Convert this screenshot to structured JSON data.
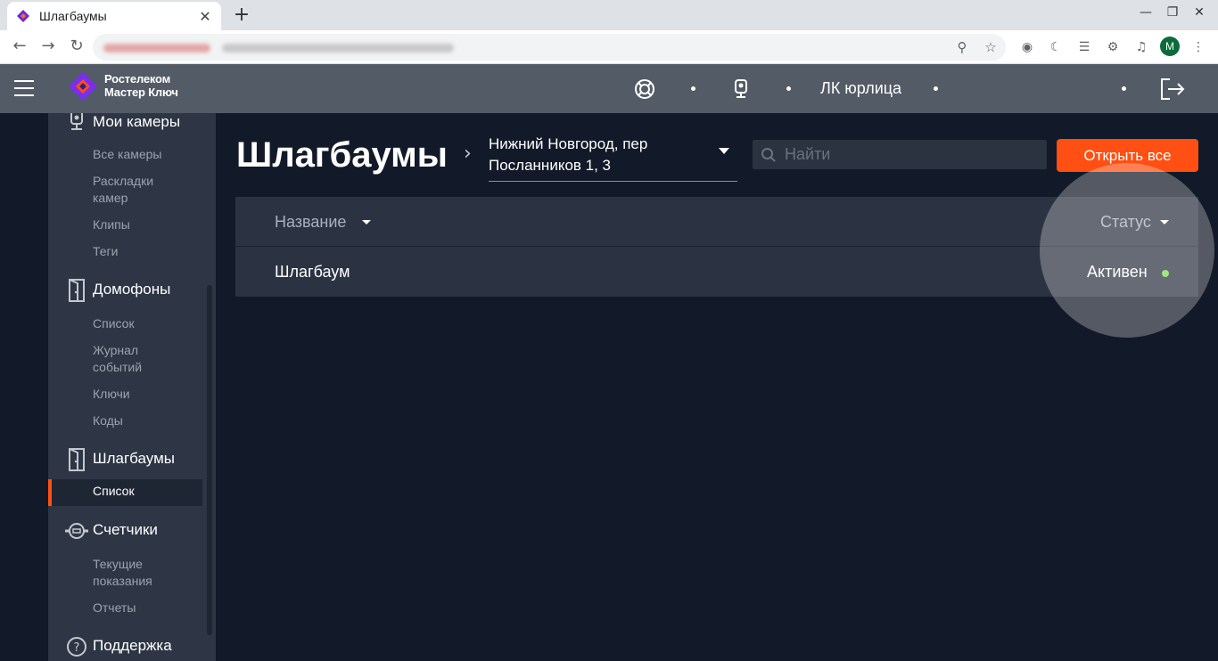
{
  "browser": {
    "tab_title": "Шлагбаумы",
    "new_tab_symbol": "+",
    "close_symbol": "✕",
    "profile_initial": "M"
  },
  "header": {
    "logo_line1": "Ростелеком",
    "logo_line2": "Мастер Ключ",
    "account_title": "ЛК юрлица"
  },
  "sidebar": {
    "sections": [
      {
        "label": "Мои камеры",
        "icon": "camera-icon",
        "items": [
          "Все камеры",
          "Раскладки камер",
          "Клипы",
          "Теги"
        ]
      },
      {
        "label": "Домофоны",
        "icon": "door-icon",
        "items": [
          "Список",
          "Журнал событий",
          "Ключи",
          "Коды"
        ]
      },
      {
        "label": "Шлагбаумы",
        "icon": "barrier-door-icon",
        "items": [
          "Список"
        ]
      },
      {
        "label": "Счетчики",
        "icon": "meter-icon",
        "items": [
          "Текущие показания",
          "Отчеты"
        ]
      },
      {
        "label": "Поддержка",
        "icon": "help-icon",
        "items": []
      }
    ],
    "sub": {
      "all_cameras": "Все камеры",
      "layouts_1": "Раскладки",
      "layouts_2": "камер",
      "clips": "Клипы",
      "tags": "Теги",
      "intercom_list": "Список",
      "journal_1": "Журнал",
      "journal_2": "событий",
      "keys": "Ключи",
      "codes": "Коды",
      "barrier_list": "Список",
      "current_1": "Текущие",
      "current_2": "показания",
      "reports": "Отчеты"
    }
  },
  "main": {
    "page_title": "Шлагбаумы",
    "address_line1": "Нижний Новгород, пер",
    "address_line2": "Посланников 1, 3",
    "search_placeholder": "Найти",
    "open_all_label": "Открыть все",
    "table": {
      "columns": {
        "name": "Название",
        "status": "Статус"
      },
      "rows": [
        {
          "name": "Шлагбаум",
          "status": "Активен",
          "status_color": "#7ed957"
        }
      ]
    }
  },
  "colors": {
    "accent": "#ff4f12",
    "header_bg": "#535b67",
    "sidebar_bg": "#2e3645",
    "page_bg": "#121a29",
    "status_active": "#7ed957"
  }
}
